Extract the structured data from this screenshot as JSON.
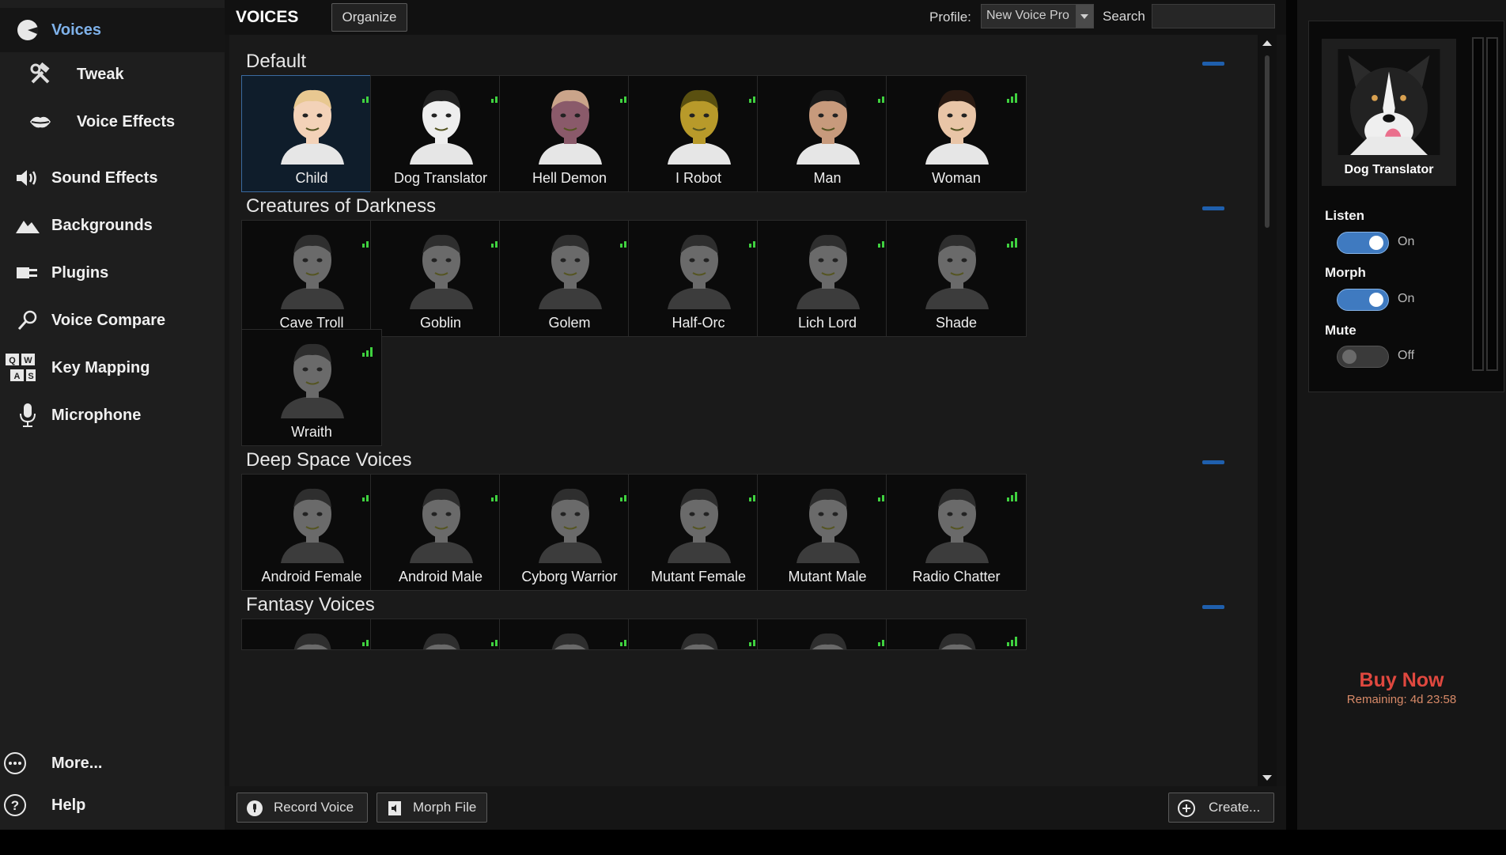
{
  "sidebar": {
    "items": [
      {
        "label": "Voices",
        "icon": "voices-icon"
      },
      {
        "label": "Tweak",
        "icon": "tools-icon"
      },
      {
        "label": "Voice Effects",
        "icon": "lips-icon"
      },
      {
        "label": "Sound Effects",
        "icon": "speaker-icon"
      },
      {
        "label": "Backgrounds",
        "icon": "landscape-icon"
      },
      {
        "label": "Plugins",
        "icon": "plug-icon"
      },
      {
        "label": "Voice Compare",
        "icon": "magnifier-icon"
      },
      {
        "label": "Key Mapping",
        "icon": "keys-icon",
        "keys": [
          "Q",
          "W",
          "A",
          "S"
        ]
      },
      {
        "label": "Microphone",
        "icon": "microphone-icon"
      }
    ],
    "more": "More...",
    "help": "Help"
  },
  "header": {
    "title": "VOICES",
    "organize": "Organize",
    "profile_label": "Profile:",
    "profile_value": "New Voice Pro",
    "search_label": "Search",
    "search_value": ""
  },
  "categories": [
    {
      "title": "Default",
      "voices": [
        "Child",
        "Dog Translator",
        "Hell Demon",
        "I Robot",
        "Man",
        "Woman"
      ]
    },
    {
      "title": "Creatures of Darkness",
      "voices": [
        "Cave Troll",
        "Goblin",
        "Golem",
        "Half-Orc",
        "Lich Lord",
        "Shade",
        "Wraith"
      ]
    },
    {
      "title": "Deep Space Voices",
      "voices": [
        "Android Female",
        "Android Male",
        "Cyborg Warrior",
        "Mutant Female",
        "Mutant Male",
        "Radio Chatter"
      ]
    },
    {
      "title": "Fantasy Voices",
      "voices": [
        "",
        "",
        "",
        "",
        "",
        ""
      ]
    }
  ],
  "selected_voice": "Child",
  "footer": {
    "record": "Record Voice",
    "morph": "Morph File",
    "create": "Create..."
  },
  "right_panel": {
    "current_voice": "Dog Translator",
    "listen_label": "Listen",
    "listen_state": "On",
    "morph_label": "Morph",
    "morph_state": "On",
    "mute_label": "Mute",
    "mute_state": "Off",
    "buy_now": "Buy Now",
    "remaining": "Remaining: 4d 23:58"
  },
  "colors": {
    "accent": "#3f7ac0",
    "signal": "#3fd13f",
    "buy": "#e0483f"
  }
}
